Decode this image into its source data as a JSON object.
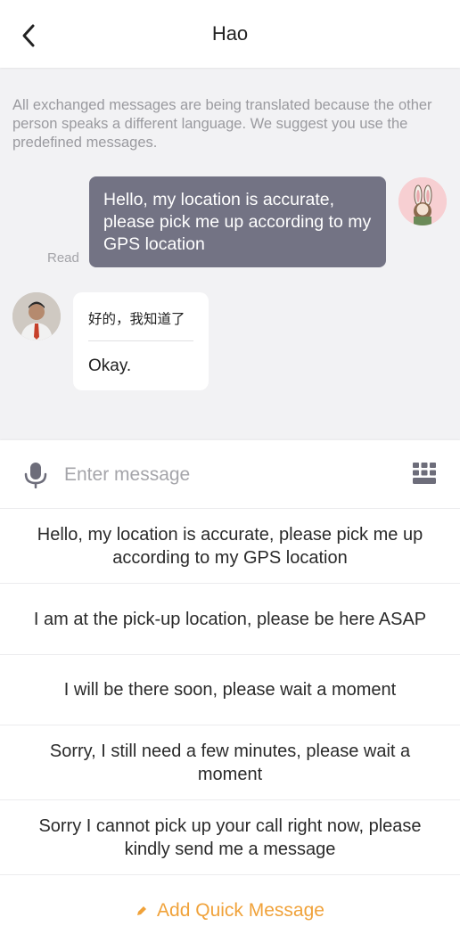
{
  "header": {
    "title": "Hao"
  },
  "chat": {
    "notice": "All exchanged messages are being translated because the other person speaks a different language. We suggest you use the predefined messages.",
    "outgoing": {
      "text": "Hello, my location is accurate, please pick me up according to my GPS location",
      "status": "Read"
    },
    "incoming": {
      "original": "好的，我知道了",
      "translation": "Okay."
    }
  },
  "input": {
    "placeholder": "Enter message",
    "value": ""
  },
  "quick_messages": [
    "Hello, my location is accurate, please pick me up according to my GPS location",
    "I am at the pick-up location, please be here ASAP",
    "I will be there soon, please wait a moment",
    "Sorry, I still need a few minutes, please wait a moment",
    "Sorry I cannot pick up your call right now, please kindly send me a message"
  ],
  "add_quick_label": "Add Quick Message",
  "icons": {
    "back": "chevron-left-icon",
    "mic": "microphone-icon",
    "keyboard": "keyboard-icon",
    "add": "pencil-icon"
  },
  "colors": {
    "outgoing_bubble": "#737384",
    "chat_background": "#f2f2f4",
    "accent": "#f0a23a"
  }
}
